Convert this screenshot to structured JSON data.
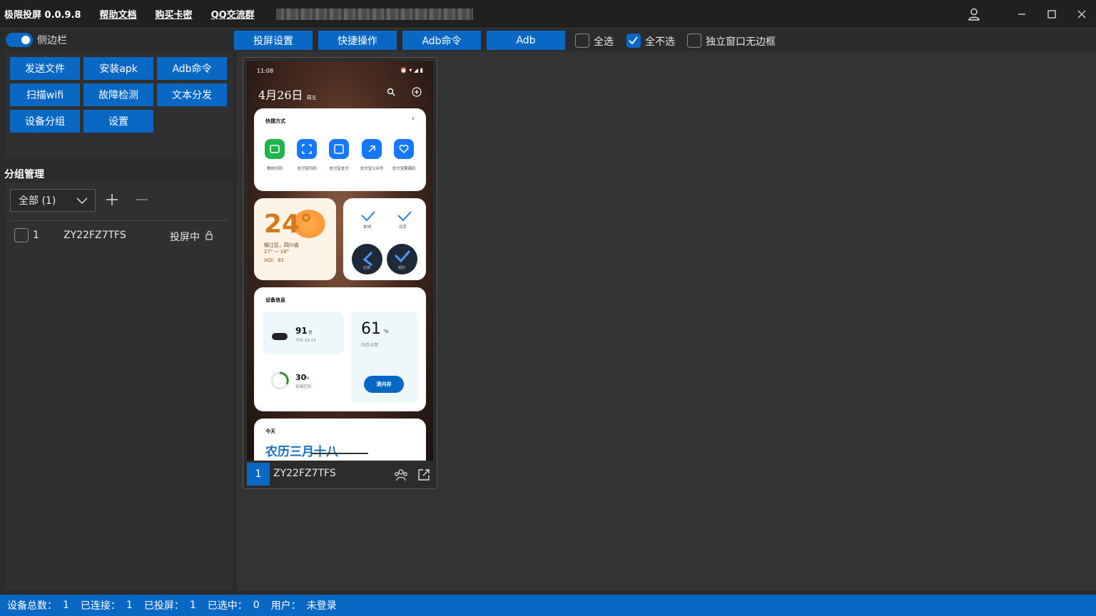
{
  "titlebar": {
    "title": "极限投屏 0.0.9.8",
    "links": [
      "帮助文档",
      "购买卡密",
      "QQ交流群"
    ]
  },
  "sidebar": {
    "toggle_label": "侧边栏",
    "quick_buttons": [
      "发送文件",
      "安装apk",
      "Adb命令",
      "扫描wifi",
      "故障检测",
      "文本分发",
      "设备分组",
      "设置"
    ],
    "group_title": "分组管理",
    "group_dropdown": "全部 (1)",
    "devices": [
      {
        "index": "1",
        "serial": "ZY22FZ7TFS",
        "status": "投屏中",
        "checked": false
      }
    ]
  },
  "toolbar": {
    "buttons": [
      "投屏设置",
      "快捷操作",
      "Adb命令",
      "Adb"
    ],
    "checkboxes": [
      {
        "label": "全选",
        "checked": false
      },
      {
        "label": "全不选",
        "checked": true
      },
      {
        "label": "独立窗口无边框",
        "checked": false
      }
    ]
  },
  "device_card": {
    "index": "1",
    "serial": "ZY22FZ7TFS",
    "screen": {
      "time": "11:08",
      "date": "4月26日",
      "weekday": "周五",
      "shortcuts_title": "快捷方式",
      "shortcuts": [
        "微信扫码",
        "支付宝扫码",
        "支付宝支付",
        "支付宝公众号",
        "支付宝健康码"
      ],
      "weather": {
        "temp": "24°",
        "location": "锦江区，四川省",
        "range": "27° ~ 18°",
        "aqi": "AQI：81"
      },
      "clocks": [
        "本地",
        "北京",
        "伦敦",
        "纽约"
      ],
      "device_info_title": "设备信息",
      "battery": {
        "value": "91",
        "unit": "台",
        "sub": "今日 10:13"
      },
      "memory": {
        "value": "61",
        "unit": "%",
        "sub": "内存占用",
        "button": "清内存"
      },
      "storage": {
        "value": "30",
        "unit": "%",
        "sub": "存储空间"
      },
      "today_title": "今天",
      "lunar": "农历三月十八"
    }
  },
  "statusbar": {
    "items": [
      {
        "label": "设备总数：",
        "value": "1"
      },
      {
        "label": "已连接：",
        "value": "1"
      },
      {
        "label": "已投屏：",
        "value": "1"
      },
      {
        "label": "已选中：",
        "value": "0"
      },
      {
        "label": "用户：",
        "value": "未登录"
      }
    ]
  },
  "colors": {
    "accent": "#0a68c5",
    "background": "#2b2b2b",
    "panel": "#303030"
  }
}
